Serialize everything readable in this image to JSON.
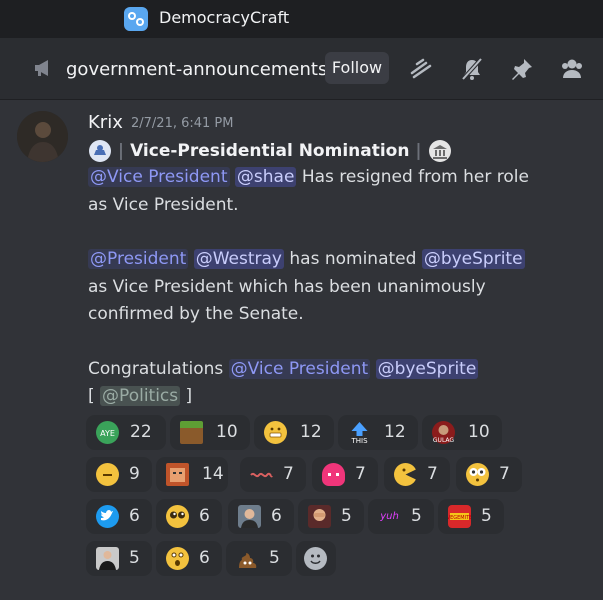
{
  "server": {
    "name": "DemocracyCraft"
  },
  "channel": {
    "name": "government-announcements",
    "follow_label": "Follow"
  },
  "message": {
    "author": "Krix",
    "timestamp": "2/7/21, 6:41 PM",
    "title": "Vice-Presidential Nomination",
    "sep": "|",
    "line1": {
      "role": "@Vice President",
      "user": "@shae",
      "text": "Has resigned from her role"
    },
    "line2": "as Vice President.",
    "line3": {
      "role": "@President",
      "user": "@Westray",
      "text": "has nominated",
      "user2": "@byeSprite"
    },
    "line4": "as Vice President which has been unanimously",
    "line5": "confirmed by the Senate.",
    "line6": {
      "text": "Congratulations",
      "role": "@Vice President",
      "user": "@byeSprite"
    },
    "line7": {
      "open": "[",
      "role": "@Politics",
      "close": "]"
    }
  },
  "reactions": [
    {
      "emoji": "aye-emoji",
      "count": "22"
    },
    {
      "emoji": "grass-block-emoji",
      "count": "10"
    },
    {
      "emoji": "grimace-emoji",
      "count": "12"
    },
    {
      "emoji": "this-arrow-emoji",
      "count": "12"
    },
    {
      "emoji": "gulag-emoji",
      "count": "10"
    },
    {
      "emoji": "neutral-face-emoji",
      "count": "9"
    },
    {
      "emoji": "pixel-face-emoji",
      "count": "14"
    },
    {
      "emoji": "wave-text-emoji",
      "count": "7"
    },
    {
      "emoji": "pink-blob-emoji",
      "count": "7"
    },
    {
      "emoji": "pacman-face-emoji",
      "count": "7"
    },
    {
      "emoji": "flushed-eyes-emoji",
      "count": "7"
    },
    {
      "emoji": "twitter-bird-emoji",
      "count": "6"
    },
    {
      "emoji": "pleading-eyes-emoji",
      "count": "6"
    },
    {
      "emoji": "man-portrait-emoji",
      "count": "6"
    },
    {
      "emoji": "facepalm-emoji",
      "count": "5"
    },
    {
      "emoji": "yuh-text-emoji",
      "count": "5"
    },
    {
      "emoji": "vegemite-emoji",
      "count": "5"
    },
    {
      "emoji": "man-praying-emoji",
      "count": "5"
    },
    {
      "emoji": "astonished-emoji",
      "count": "6"
    },
    {
      "emoji": "poop-emoji",
      "count": "5"
    },
    {
      "emoji": "add-reaction-icon",
      "count": ""
    }
  ],
  "colors": {
    "background": "#313338",
    "mention": "#c9cdfb",
    "accent": "#5865f2"
  }
}
